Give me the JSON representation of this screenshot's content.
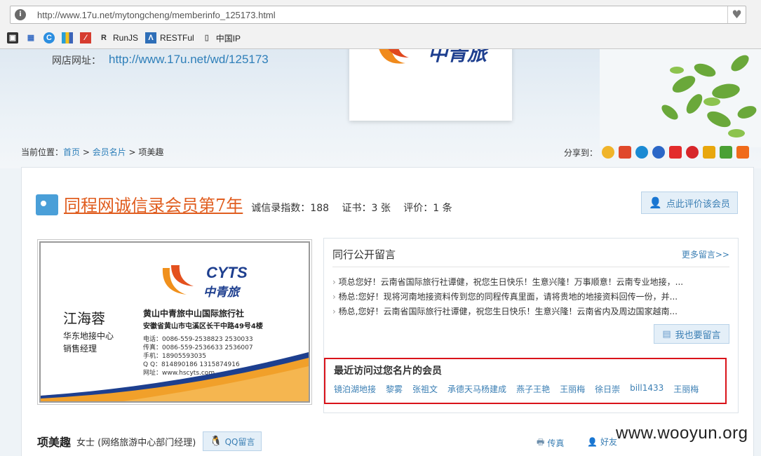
{
  "browser": {
    "url": "http://www.17u.net/mytongcheng/memberinfo_125173.html",
    "bookmarks": [
      {
        "label": "",
        "icon": "tab-icon"
      },
      {
        "label": "",
        "icon": "apps-grid-icon"
      },
      {
        "label": "",
        "icon": "refresh-c-icon"
      },
      {
        "label": "",
        "icon": "color-chart-icon"
      },
      {
        "label": "",
        "icon": "red-square-icon"
      },
      {
        "label": "RunJS",
        "icon": "runjs-icon"
      },
      {
        "label": "RESTFul",
        "icon": "restful-icon"
      },
      {
        "label": "中国IP",
        "icon": "page-icon"
      }
    ]
  },
  "banner": {
    "shop_label": "网店网址：",
    "shop_url": "http://www.17u.net/wd/125173"
  },
  "breadcrumb": {
    "prefix": "当前位置：",
    "home": "首页",
    "sep1": " > ",
    "cards": "会员名片",
    "sep2": " > ",
    "current": "项美趣"
  },
  "share": {
    "label": "分享到：",
    "colors": [
      "#f0b42a",
      "#e0492b",
      "#1a8ad3",
      "#2b67c7",
      "#e32c2c",
      "#d7262a",
      "#e8a70d",
      "#4aa034",
      "#f06b1a"
    ]
  },
  "member": {
    "title": "同程网诚信录会员第7年",
    "index_label": "诚信录指数：188",
    "cert_label": "证书：3 张",
    "review_label": "评价：1 条",
    "rate_button": "点此评价该会员"
  },
  "business_card": {
    "brand_en": "CYTS",
    "brand_cn": "中青旅",
    "name": "江海蓉",
    "dept": "华东地接中心",
    "title": "销售经理",
    "company": "黄山中青旅中山国际旅行社",
    "address": "安徽省黄山市屯溪区长干中路49号4楼",
    "phone": "电话：0086-559-2538823    2530033",
    "fax": "传真：0086-559-2536633    2536007",
    "mobile": "手机：18905593035",
    "qq": "Q Q：814890186    1315874916",
    "web": "网址：www.hscyts.com"
  },
  "messages": {
    "heading": "同行公开留言",
    "more": "更多留言>>",
    "items": [
      "项总您好！云南省国际旅行社谭健，祝您生日快乐！生意兴隆！万事顺意！云南专业地接，...",
      "杨总:您好！现将河南地接资料传到您的同程传真里面，请将贵地的地接资料回传一份，并...",
      "杨总,您好！云南省国际旅行社谭健，祝您生日快乐！生意兴隆！云南省内及周边国家越南..."
    ],
    "leave_button": "我也要留言"
  },
  "visitors": {
    "heading": "最近访问过您名片的会员",
    "names": [
      "镜泊湖地接",
      "黎雾",
      "张祖文",
      "承德天马杨建成",
      "燕子王艳",
      "王丽梅",
      "徐日崇",
      "bill1433",
      "王丽梅"
    ]
  },
  "profile": {
    "name": "项美趣",
    "info": "女士 (网络旅游中心部门经理)",
    "qq_button": "QQ留言",
    "fax_action": "传真",
    "friend_action": "好友"
  },
  "watermark": "www.wooyun.org"
}
